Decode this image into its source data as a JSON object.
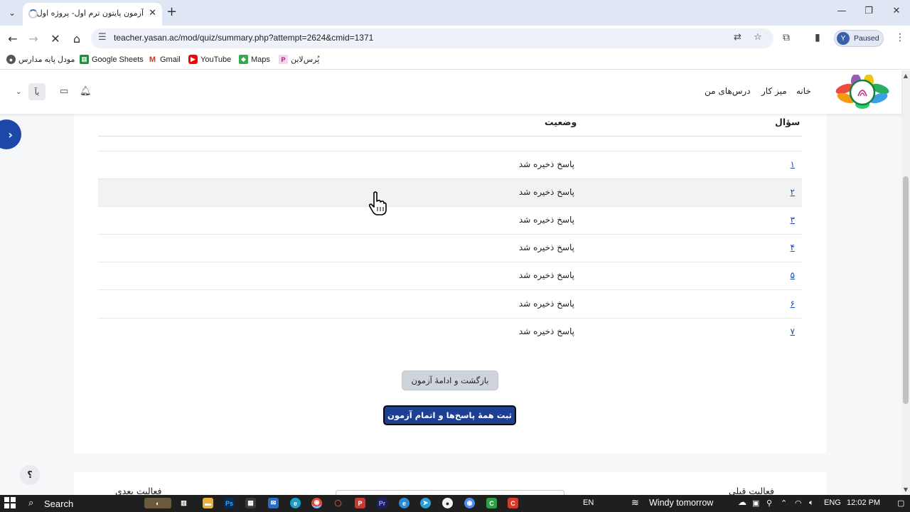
{
  "browser": {
    "tab_title": "آزمون پایتون ترم اول- پروژه اول ما",
    "url": "teacher.yasan.ac/mod/quiz/summary.php?attempt=2624&cmid=1371",
    "profile_initial": "Y",
    "profile_status": "Paused",
    "bookmarks": [
      {
        "label": "مودل پایه مدارس",
        "icon": "globe-icon"
      },
      {
        "label": "Google Sheets",
        "icon": "sheets-icon",
        "color": "#1e8e3e"
      },
      {
        "label": "Gmail",
        "icon": "gmail-icon",
        "color": "#d93025"
      },
      {
        "label": "YouTube",
        "icon": "youtube-icon",
        "color": "#ff0000"
      },
      {
        "label": "Maps",
        "icon": "maps-icon",
        "color": "#34a853"
      },
      {
        "label": "پُرس‌لاین",
        "icon": "porsline-icon",
        "color": "#d63aa8"
      }
    ]
  },
  "site": {
    "nav": {
      "home": "خانه",
      "dashboard": "میز کار",
      "my_courses": "درس‌های من"
    },
    "lang_button": "یآ"
  },
  "summary": {
    "col_question": "سؤال",
    "col_status": "وضعیت",
    "rows": [
      {
        "num": "۱",
        "status": "پاسخ ذخیره شد"
      },
      {
        "num": "۲",
        "status": "پاسخ ذخیره شد"
      },
      {
        "num": "۳",
        "status": "پاسخ ذخیره شد"
      },
      {
        "num": "۴",
        "status": "پاسخ ذخیره شد"
      },
      {
        "num": "۵",
        "status": "پاسخ ذخیره شد"
      },
      {
        "num": "۶",
        "status": "پاسخ ذخیره شد"
      },
      {
        "num": "۷",
        "status": "پاسخ ذخیره شد"
      }
    ],
    "return_button": "بازگشت و ادامهٔ آزمون",
    "submit_button": "ثبت همهٔ پاسخ‌ها و اتمام آزمون"
  },
  "footer_nav": {
    "previous": "فعالیت قبلی",
    "next": "فعالیت بعدی"
  },
  "help_button": "؟",
  "colors": {
    "primary": "#1d3f94",
    "link": "#1a4ab8",
    "drawer": "#1d47a8"
  },
  "taskbar": {
    "search_label": "Search",
    "language_short": "EN",
    "weather": "Windy tomorrow",
    "input_lang": "ENG",
    "time": "12:02 PM"
  }
}
